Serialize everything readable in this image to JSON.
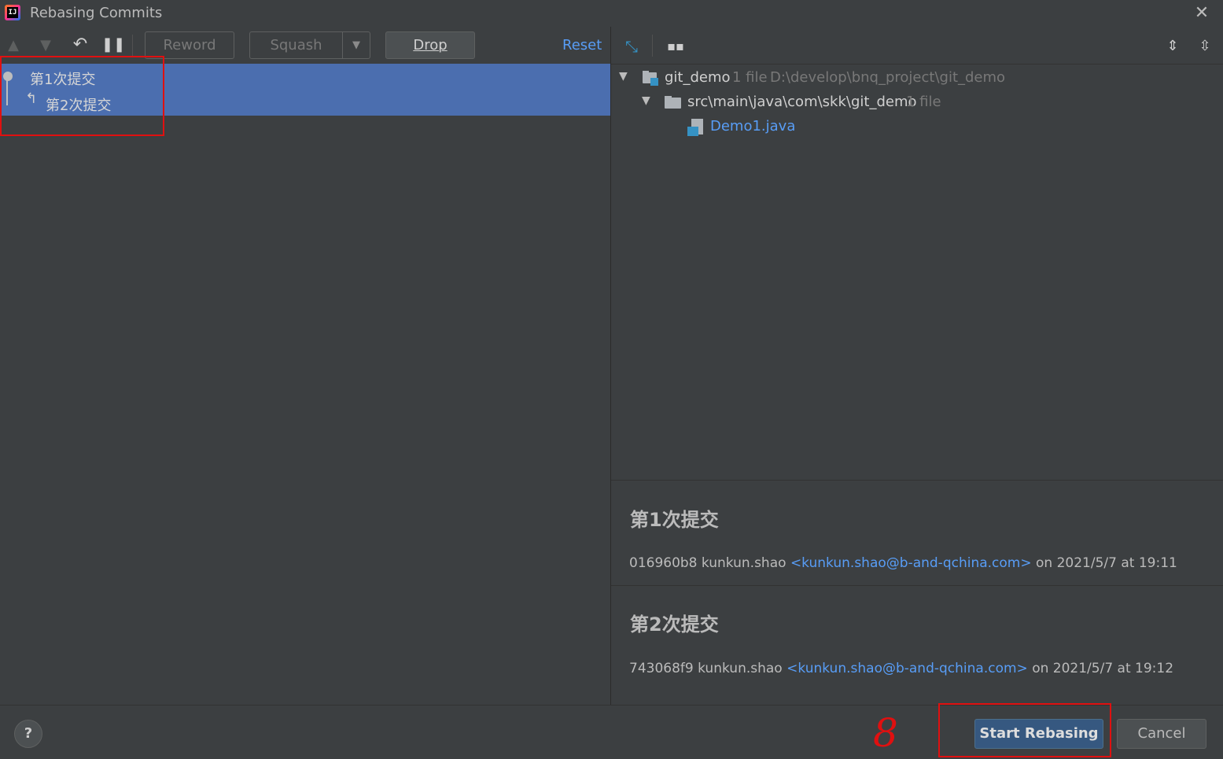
{
  "window": {
    "title": "Rebasing Commits",
    "logo_text": "IJ"
  },
  "toolbar": {
    "reword_label": "Reword",
    "squash_label": "Squash",
    "drop_label": "Drop",
    "reset_label": "Reset",
    "icons": [
      "arrow-up-icon",
      "arrow-down-icon",
      "undo-icon",
      "pause-icon"
    ]
  },
  "commits": [
    {
      "label": "第1次提交"
    },
    {
      "label": "第2次提交"
    }
  ],
  "tree": {
    "root": {
      "name": "git_demo",
      "count": "1 file",
      "path": "D:\\develop\\bnq_project\\git_demo"
    },
    "folder": {
      "name": "src\\main\\java\\com\\skk\\git_demo",
      "count": "1 file"
    },
    "file": {
      "name": "Demo1.java"
    }
  },
  "details": [
    {
      "title": "第1次提交",
      "hash": "016960b8",
      "author": "kunkun.shao",
      "email": "<kunkun.shao@b-and-qchina.com>",
      "date": "on 2021/5/7 at 19:11"
    },
    {
      "title": "第2次提交",
      "hash": "743068f9",
      "author": "kunkun.shao",
      "email": "<kunkun.shao@b-and-qchina.com>",
      "date": "on 2021/5/7 at 19:12"
    }
  ],
  "footer": {
    "help_label": "?",
    "start_label": "Start Rebasing",
    "cancel_label": "Cancel",
    "annotation": "8"
  },
  "colors": {
    "background": "#3c3f41",
    "selection": "#4b6eaf",
    "link": "#589df6",
    "primary_button": "#365880",
    "annotation_red": "#e01010"
  }
}
